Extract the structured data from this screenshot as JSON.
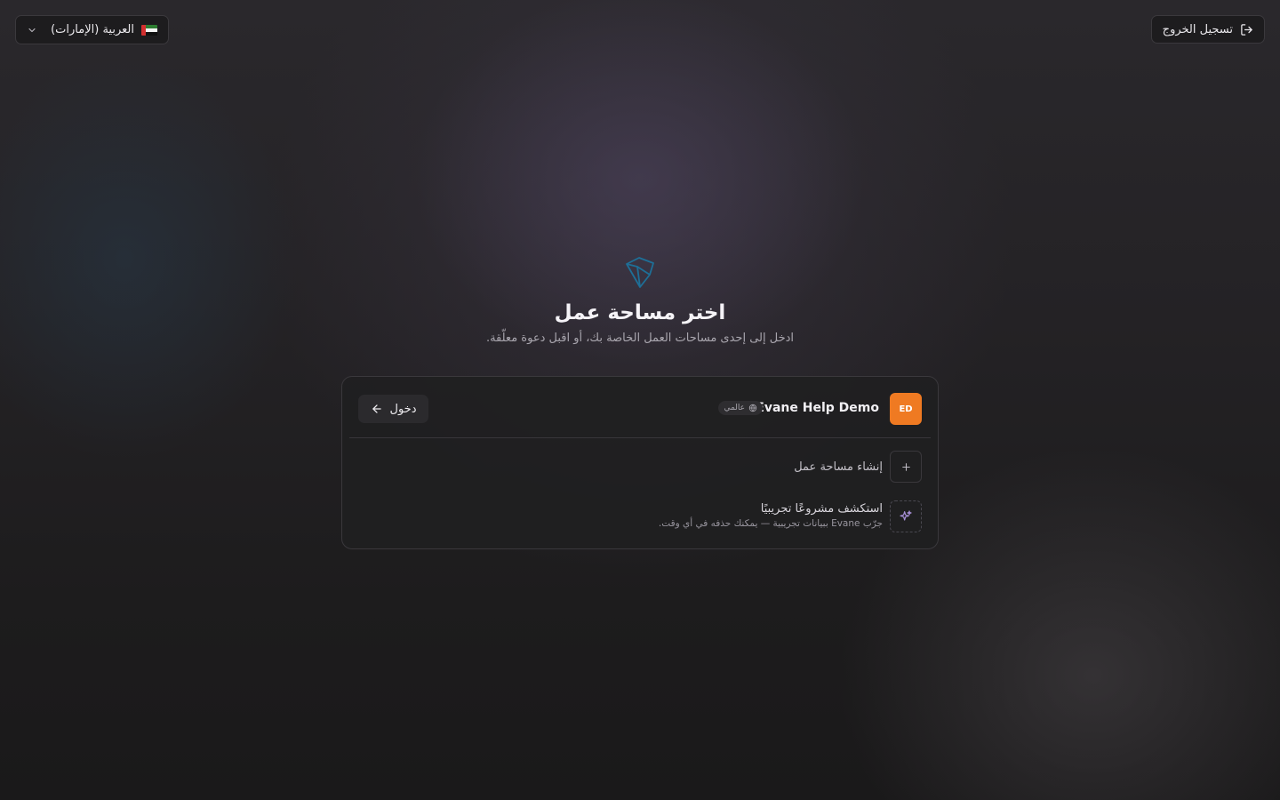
{
  "header": {
    "logout_label": "تسجيل الخروج",
    "language_label": "العربية (الإمارات)"
  },
  "icons": {
    "logout": "logout-icon",
    "flag": "uae-flag-icon",
    "chevron": "chevron-down-icon",
    "logo": "app-logo",
    "globe": "globe-icon",
    "arrow": "arrow-left-icon",
    "plus": "plus-icon",
    "sparkle": "sparkles-icon"
  },
  "main": {
    "title": "اختر مساحة عمل",
    "subtitle": "ادخل إلى إحدى مساحات العمل الخاصة بك، أو اقبل دعوة معلّقة."
  },
  "workspaces": [
    {
      "initials": "ED",
      "name": "Evane Help Demo",
      "badge": "عالمي",
      "enter_label": "دخول",
      "avatar_color": "#ef7a22"
    }
  ],
  "actions": {
    "create_label": "إنشاء مساحة عمل",
    "demo_title": "استكشف مشروعًا تجريبيًا",
    "demo_description": "جرّب Evane ببيانات تجريبية — يمكنك حذفه في أي وقت."
  },
  "colors": {
    "accent": "#ef7a22",
    "logo": "#1e6f97",
    "background": "#1c1b1c"
  }
}
